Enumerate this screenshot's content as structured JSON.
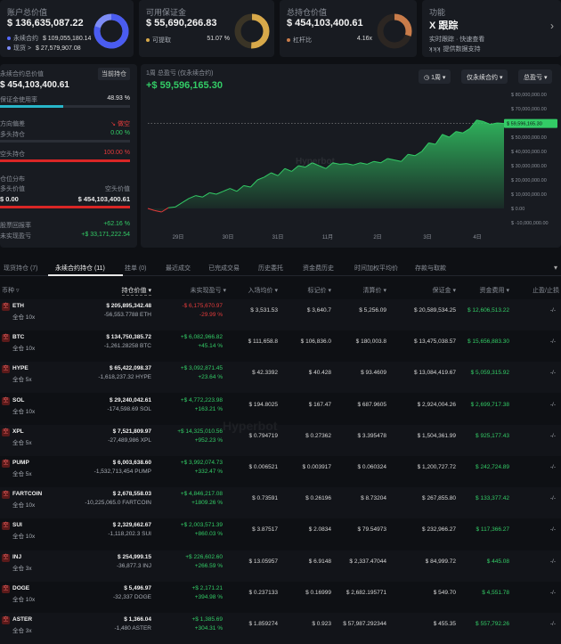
{
  "cards": [
    {
      "title": "账户总价值",
      "value": "$ 136,635,087.22",
      "sub1_label": "永续合约",
      "sub1_value": "$ 109,055,180.14",
      "sub2_label": "现货 >",
      "sub2_value": "$ 27,579,907.08",
      "colors": [
        "#5468ff",
        "#7d8cf5"
      ]
    },
    {
      "title": "可用保证金",
      "value": "$ 55,690,266.83",
      "sub1_label": "可提取",
      "sub1_value": "51.07 %",
      "ring_fraction": 0.51,
      "ring_color": "#d8a94a"
    },
    {
      "title": "总持仓价值",
      "value": "$ 454,103,400.61",
      "sub1_label": "杠杆比",
      "sub1_value": "4.16x",
      "ring_fraction": 0.3,
      "ring_color": "#c97c4a"
    },
    {
      "title": "功能",
      "value": "X 跟踪",
      "sub1_label": "实时跟踪 · 快速查看",
      "sub2_label": "提供数据支持"
    }
  ],
  "left_panel": {
    "title": "永续合约总价值",
    "tag": "当前持仓",
    "value": "$ 454,103,400.61",
    "margin_label": "保证金使用率",
    "margin_value": "48.93 %",
    "margin_fraction": 0.4893,
    "direction_label": "方向偏差",
    "direction_value": "做空",
    "long_label": "多头持仓",
    "long_value": "0.00 %",
    "short_label": "空头持仓",
    "short_value": "100.00 %",
    "dist_label": "仓位分布",
    "long_value_label": "多头价值",
    "short_value_label": "空头价值",
    "long_amount": "$ 0.00",
    "short_amount": "$ 454,103,400.61",
    "roe_label": "股票回报率",
    "roe_value": "+62.16 %",
    "upnl_label": "未实现盈亏",
    "upnl_value": "+$ 33,171,222.54"
  },
  "chart_panel": {
    "title": "1周 总盈亏 (仅永续合约)",
    "value": "+$ 59,596,165.30",
    "dropdowns": [
      "1周",
      "仅永续合约",
      "总盈亏"
    ],
    "current_label": "$ 59,596,165.30",
    "watermark": "Hyperbot"
  },
  "chart_data": {
    "type": "area",
    "x_ticks": [
      "29日",
      "30日",
      "31日",
      "11月",
      "2日",
      "3日",
      "4日"
    ],
    "y_ticks": [
      "$ 80,000,000.00",
      "$ 70,000,000.00",
      "$ 60,000,000.00",
      "$ 50,000,000.00",
      "$ 40,000,000.00",
      "$ 30,000,000.00",
      "$ 20,000,000.00",
      "$ 10,000,000.00",
      "$ 0.00",
      "$ -10,000,000.00"
    ],
    "ylim": [
      -10000000,
      80000000
    ],
    "values": [
      0,
      -1500000,
      -2500000,
      500000,
      1000000,
      4000000,
      7000000,
      9000000,
      8000000,
      11000000,
      10000000,
      12000000,
      14000000,
      12000000,
      16000000,
      15000000,
      20000000,
      22000000,
      25000000,
      23000000,
      28000000,
      26000000,
      30000000,
      29000000,
      32000000,
      30000000,
      28000000,
      32000000,
      31000000,
      31500000,
      30500000,
      32000000,
      31000000,
      33000000,
      32000000,
      35000000,
      34000000,
      33000000,
      38000000,
      37000000,
      40000000,
      46000000,
      45000000,
      52000000,
      50000000,
      54000000,
      53000000,
      56000000,
      62000000,
      61000000,
      59000000,
      60000000,
      59596165
    ],
    "series_color": "#33cc66",
    "loss_color": "#e33b3b"
  },
  "tabs": [
    "现货持仓 (7)",
    "永续合约持仓 (11)",
    "挂单 (0)",
    "最近成交",
    "已完成交易",
    "历史委托",
    "资金费历史",
    "时间加权平均价",
    "存款与取款"
  ],
  "active_tab": 1,
  "table": {
    "headers": [
      "币种",
      "持仓价值",
      "未实现盈亏",
      "入场均价",
      "标记价",
      "清算价",
      "保证金",
      "资金费用",
      "止盈/止损"
    ],
    "rows": [
      {
        "coin": "ETH",
        "sub": "全仓 10x",
        "value": "$ 205,895,342.48",
        "qty": "-56,553.7788 ETH",
        "pnl": "-$ 6,175,670.97",
        "pnl_pct": "-29.99 %",
        "pnl_pos": false,
        "entry": "$ 3,531.53",
        "mark": "$ 3,640.7",
        "liq": "$ 5,256.09",
        "margin": "$ 20,589,534.25",
        "funding": "$ 12,606,513.22",
        "tpsl": "-/-"
      },
      {
        "coin": "BTC",
        "sub": "全仓 10x",
        "value": "$ 134,750,385.72",
        "qty": "-1,261.28258 BTC",
        "pnl": "+$ 6,082,966.82",
        "pnl_pct": "+45.14 %",
        "pnl_pos": true,
        "entry": "$ 111,658.8",
        "mark": "$ 106,836.0",
        "liq": "$ 180,003.8",
        "margin": "$ 13,475,038.57",
        "funding": "$ 15,656,883.30",
        "tpsl": "-/-"
      },
      {
        "coin": "HYPE",
        "sub": "全仓 5x",
        "value": "$ 65,422,098.37",
        "qty": "-1,618,237.32 HYPE",
        "pnl": "+$ 3,092,871.45",
        "pnl_pct": "+23.64 %",
        "pnl_pos": true,
        "entry": "$ 42.3392",
        "mark": "$ 40.428",
        "liq": "$ 93.4609",
        "margin": "$ 13,084,419.67",
        "funding": "$ 5,059,315.92",
        "tpsl": "-/-"
      },
      {
        "coin": "SOL",
        "sub": "全仓 10x",
        "value": "$ 29,240,042.61",
        "qty": "-174,598.69 SOL",
        "pnl": "+$ 4,772,223.98",
        "pnl_pct": "+163.21 %",
        "pnl_pos": true,
        "entry": "$ 194.8025",
        "mark": "$ 167.47",
        "liq": "$ 687.9605",
        "margin": "$ 2,924,004.26",
        "funding": "$ 2,699,717.38",
        "tpsl": "-/-"
      },
      {
        "coin": "XPL",
        "sub": "全仓 5x",
        "value": "$ 7,521,809.97",
        "qty": "-27,489,986 XPL",
        "pnl": "+$ 14,325,010.56",
        "pnl_pct": "+952.23 %",
        "pnl_pos": true,
        "entry": "$ 0.794719",
        "mark": "$ 0.27362",
        "liq": "$ 3.395478",
        "margin": "$ 1,504,361.99",
        "funding": "$ 925,177.43",
        "tpsl": "-/-"
      },
      {
        "coin": "PUMP",
        "sub": "全仓 5x",
        "value": "$ 6,003,638.60",
        "qty": "-1,532,713,454 PUMP",
        "pnl": "+$ 3,992,074.73",
        "pnl_pct": "+332.47 %",
        "pnl_pos": true,
        "entry": "$ 0.006521",
        "mark": "$ 0.003917",
        "liq": "$ 0.060324",
        "margin": "$ 1,200,727.72",
        "funding": "$ 242,724.89",
        "tpsl": "-/-"
      },
      {
        "coin": "FARTCOIN",
        "sub": "全仓 10x",
        "value": "$ 2,678,558.03",
        "qty": "-10,225,065.0 FARTCOIN",
        "pnl": "+$ 4,846,217.08",
        "pnl_pct": "+1809.26 %",
        "pnl_pos": true,
        "entry": "$ 0.73591",
        "mark": "$ 0.26196",
        "liq": "$ 8.73204",
        "margin": "$ 267,855.80",
        "funding": "$ 133,377.42",
        "tpsl": "-/-"
      },
      {
        "coin": "SUI",
        "sub": "全仓 10x",
        "value": "$ 2,329,662.67",
        "qty": "-1,118,202.3 SUI",
        "pnl": "+$ 2,003,571.39",
        "pnl_pct": "+860.03 %",
        "pnl_pos": true,
        "entry": "$ 3.87517",
        "mark": "$ 2.0834",
        "liq": "$ 79.54973",
        "margin": "$ 232,966.27",
        "funding": "$ 117,366.27",
        "tpsl": "-/-"
      },
      {
        "coin": "INJ",
        "sub": "全仓 3x",
        "value": "$ 254,999.15",
        "qty": "-36,877.3 INJ",
        "pnl": "+$ 226,602.60",
        "pnl_pct": "+266.59 %",
        "pnl_pos": true,
        "entry": "$ 13.05957",
        "mark": "$ 6.9148",
        "liq": "$ 2,337.47044",
        "margin": "$ 84,999.72",
        "funding": "$ 445.08",
        "tpsl": "-/-"
      },
      {
        "coin": "DOGE",
        "sub": "全仓 10x",
        "value": "$ 5,496.97",
        "qty": "-32,337 DOGE",
        "pnl": "+$ 2,171.21",
        "pnl_pct": "+394.98 %",
        "pnl_pos": true,
        "entry": "$ 0.237133",
        "mark": "$ 0.16999",
        "liq": "$ 2,682.195771",
        "margin": "$ 549.70",
        "funding": "$ 4,551.78",
        "tpsl": "-/-"
      },
      {
        "coin": "ASTER",
        "sub": "全仓 3x",
        "value": "$ 1,366.04",
        "qty": "-1,480 ASTER",
        "pnl": "+$ 1,385.69",
        "pnl_pct": "+304.31 %",
        "pnl_pos": true,
        "entry": "$ 1.859274",
        "mark": "$ 0.923",
        "liq": "$ 57,987.292344",
        "margin": "$ 455.35",
        "funding": "$ 557,792.26",
        "tpsl": "-/-"
      }
    ]
  },
  "watermark_table": "Hyperbot"
}
